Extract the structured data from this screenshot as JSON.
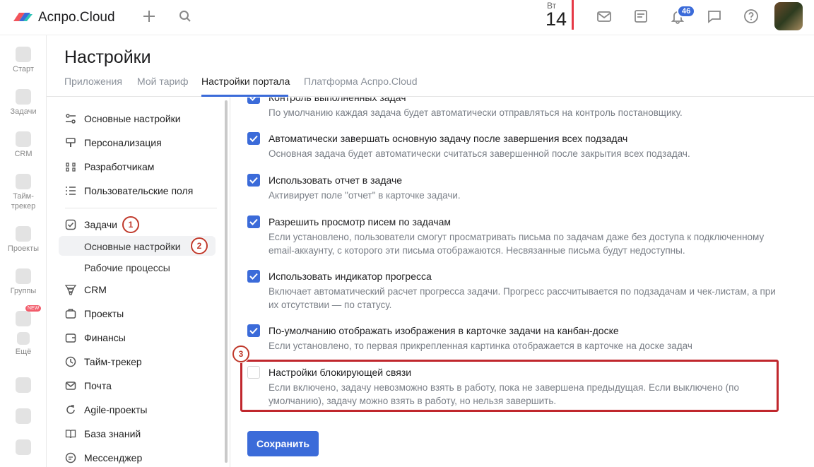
{
  "app": {
    "name": "Аспро.Cloud"
  },
  "date": {
    "dow": "Вт",
    "day": "14"
  },
  "notifications_count": "46",
  "leftnav": {
    "items": [
      {
        "label": "Старт",
        "icon": "heart-icon"
      },
      {
        "label": "Задачи",
        "icon": "check-icon"
      },
      {
        "label": "CRM",
        "icon": "funnel-icon"
      },
      {
        "label": "Тайм-\nтрекер",
        "icon": "timer-icon"
      },
      {
        "label": "Проекты",
        "icon": "projects-icon"
      },
      {
        "label": "Группы",
        "icon": "groups-icon"
      },
      {
        "label": "Ещё",
        "icon": "grid-icon"
      }
    ],
    "new_badge": "NEW"
  },
  "header": {
    "title": "Настройки",
    "tabs": [
      {
        "label": "Приложения"
      },
      {
        "label": "Мой тариф"
      },
      {
        "label": "Настройки портала"
      },
      {
        "label": "Платформа Аспро.Cloud"
      }
    ]
  },
  "sidemenu": {
    "items": [
      {
        "label": "Основные настройки",
        "icon": "sliders-icon"
      },
      {
        "label": "Персонализация",
        "icon": "brush-icon"
      },
      {
        "label": "Разработчикам",
        "icon": "code-icon"
      },
      {
        "label": "Пользовательские поля",
        "icon": "list-icon"
      },
      {
        "label": "Задачи",
        "icon": "check-square-icon"
      },
      {
        "label": "Основные настройки"
      },
      {
        "label": "Рабочие процессы"
      },
      {
        "label": "CRM",
        "icon": "funnel-icon"
      },
      {
        "label": "Проекты",
        "icon": "briefcase-icon"
      },
      {
        "label": "Финансы",
        "icon": "wallet-icon"
      },
      {
        "label": "Тайм-трекер",
        "icon": "clock-icon"
      },
      {
        "label": "Почта",
        "icon": "mail-icon"
      },
      {
        "label": "Agile-проекты",
        "icon": "refresh-icon"
      },
      {
        "label": "База знаний",
        "icon": "book-icon"
      },
      {
        "label": "Мессенджер",
        "icon": "chat-icon"
      }
    ]
  },
  "markers": [
    "1",
    "2",
    "3"
  ],
  "options": [
    {
      "title": "Контроль выполненных задач",
      "desc": "По умолчанию каждая задача будет автоматически отправляться на контроль постановщику.",
      "checked": true
    },
    {
      "title": "Автоматически завершать основную задачу после завершения всех подзадач",
      "desc": "Основная задача будет автоматически считаться завершенной после закрытия всех подзадач.",
      "checked": true
    },
    {
      "title": "Использовать отчет в задаче",
      "desc": "Активирует поле \"отчет\" в карточке задачи.",
      "checked": true
    },
    {
      "title": "Разрешить просмотр писем по задачам",
      "desc": "Если установлено, пользователи смогут просматривать письма по задачам даже без доступа к подключенному email-аккаунту, с которого эти письма отображаются. Несвязанные письма будут недоступны.",
      "checked": true
    },
    {
      "title": "Использовать индикатор прогресса",
      "desc": "Включает автоматический расчет прогресса задачи. Прогресс рассчитывается по подзадачам и чек-листам, а при их отсутствии — по статусу.",
      "checked": true
    },
    {
      "title": "По-умолчанию отображать изображения в карточке задачи на канбан-доске",
      "desc": "Если установлено, то первая прикрепленная картинка отображается в карточке на доске задач",
      "checked": true
    },
    {
      "title": "Настройки блокирующей связи",
      "desc": "Если включено, задачу невозможно взять в работу, пока не завершена предыдущая. Если выключено (по умолчанию), задачу можно взять в работу, но нельзя завершить.",
      "checked": false
    }
  ],
  "save_label": "Сохранить"
}
